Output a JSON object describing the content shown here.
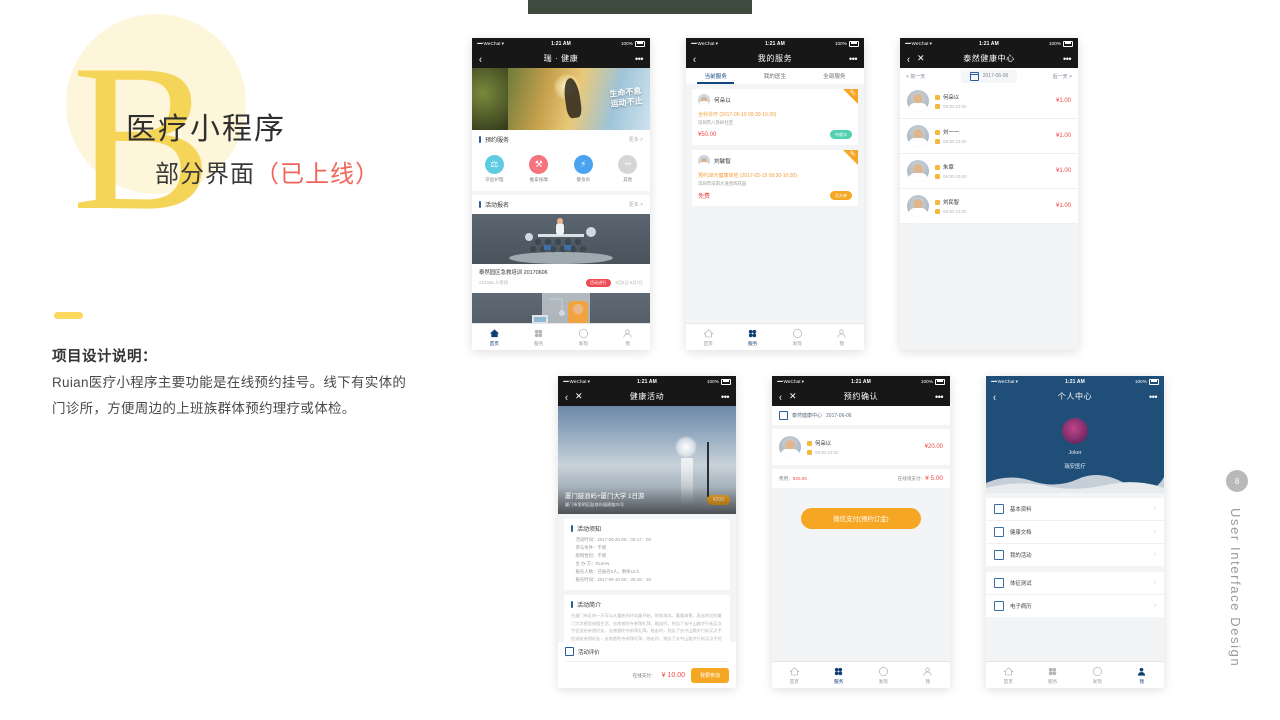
{
  "slide": {
    "section_letter": "B",
    "title": "医疗小程序",
    "subtitle_main": "部分界面",
    "subtitle_note": "（已上线）",
    "desc_heading": "项目设计说明：",
    "desc_body": "Ruian医疗小程序主要功能是在线预约挂号。线下有实体的门诊所，方便周边的上班族群体预约理疗或体检。",
    "rail_text": "User Interface Design",
    "page_badge": "8",
    "accent_yellow": "#f5d558",
    "accent_red": "#f0655a",
    "accent_blue": "#1f4e79"
  },
  "status_bar": {
    "carrier_dots": "•••••",
    "carrier": "WeChat",
    "wifi": "▾",
    "time": "1:21 AM",
    "battery": "100%"
  },
  "phone1": {
    "nav": {
      "back": "‹",
      "title": "瑞 · 健康",
      "more": "•••"
    },
    "hero_slogan_1": "生命不息",
    "hero_slogan_2": "运动不止",
    "section_services": {
      "label": "预约服务",
      "more": "更多 >"
    },
    "services": [
      {
        "label": "牙齿护理",
        "icon": "tooth-icon",
        "color": "#5ecbe2",
        "glyph": "⚕"
      },
      {
        "label": "推拿按摩",
        "icon": "massage-icon",
        "color": "#f4737d",
        "glyph": "⚘"
      },
      {
        "label": "健身房",
        "icon": "gym-icon",
        "color": "#4aa3f0",
        "glyph": "⚡"
      },
      {
        "label": "其他",
        "icon": "more-dots-icon",
        "color": "#d6d6d6",
        "glyph": "•••"
      }
    ],
    "section_activities": {
      "label": "活动报名",
      "more": "更多 >"
    },
    "activity": {
      "title": "泰然园区急救培训 20170606",
      "subtitle": "212345 人参加",
      "badge": "活动进行",
      "date": "6月6日-6月7日"
    },
    "tabbar": [
      {
        "label": "首页",
        "icon": "home-icon",
        "active": true
      },
      {
        "label": "服务",
        "icon": "grid-icon",
        "active": false
      },
      {
        "label": "发现",
        "icon": "compass-icon",
        "active": false
      },
      {
        "label": "我",
        "icon": "person-icon",
        "active": false
      }
    ]
  },
  "phone2": {
    "nav": {
      "back": "‹",
      "title": "我的服务",
      "more": "•••"
    },
    "tabs": [
      {
        "label": "当前服务",
        "active": true
      },
      {
        "label": "我的医生",
        "active": false
      },
      {
        "label": "全部服务",
        "active": false
      }
    ],
    "cards": [
      {
        "doctor": "何朵以",
        "corner": "预约",
        "service": "全科诊疗 (2017-05-19 09:30-10:30)",
        "address": "深圳市八卦岭社区",
        "price": "¥50.00",
        "status": "待就诊",
        "status_color": "green"
      },
      {
        "doctor": "刘敏智",
        "corner": "预约",
        "service": "预约38元健康体检 (2017-05-19 09:30-10:30)",
        "address": "深圳市深南大道金辉花园",
        "price": "免费",
        "status": "总方单",
        "status_color": "orange"
      }
    ],
    "tabbar": [
      {
        "label": "首页",
        "icon": "home-icon",
        "active": false
      },
      {
        "label": "服务",
        "icon": "grid-icon",
        "active": true
      },
      {
        "label": "发现",
        "icon": "compass-icon",
        "active": false
      },
      {
        "label": "我",
        "icon": "person-icon",
        "active": false
      }
    ]
  },
  "phone3": {
    "nav": {
      "back": "‹",
      "close": "✕",
      "title": "泰然健康中心",
      "more": "•••"
    },
    "date_bar": {
      "prev": "< 前一天",
      "date": "2017-06-06",
      "next": "后一天 >"
    },
    "doctors": [
      {
        "name": "何朵以",
        "time": "09:30-10:00",
        "price": "¥1.00"
      },
      {
        "name": "刘一一",
        "time": "09:30-10:00",
        "price": "¥1.00"
      },
      {
        "name": "朱章",
        "time": "09:30-10:00",
        "price": "¥1.00"
      },
      {
        "name": "刘民智",
        "time": "09:30-10:00",
        "price": "¥1.00"
      }
    ]
  },
  "phone4": {
    "nav": {
      "back": "‹",
      "close": "✕",
      "title": "健康活动",
      "more": "•••"
    },
    "hero": {
      "title": "厦门鼓浪屿+厦门大学 1日游",
      "address": "厦门市思明区鼓浪屿福建路31号",
      "price_badge": "¥200"
    },
    "notice": {
      "label": "活动须知",
      "items": [
        "活动时间：2017-06-20 09：00-17：00",
        "参与条件：不限",
        "限制性别：不限",
        "主 办 方：RUIAN",
        "报名人数：已报名0人，剩余10人",
        "报名时间：2017-06-10 09：30-16：30"
      ]
    },
    "intro": {
      "label": "活动简介",
      "text": "在厦门市区的一天可以从重新的环岛路开始，吹吹海风，看看海景，再去附近的厦门大学感受校园生活，去南普陀寺参拜礼拜，临走时，到店了去中山路步行街买点手信送给亲朋好友，去南普陀寺参拜礼拜，临走时，到店了去中山路步行街买点手信送给亲朋好友，去南普陀寺参拜礼拜，临走时，到店了去中山路步行街买点手信送给亲朋好友。"
    },
    "pay": {
      "review_label": "活动评价",
      "online_label": "在线支付：",
      "amount": "¥ 10.00",
      "button": "我要参加"
    }
  },
  "phone5": {
    "nav": {
      "back": "‹",
      "close": "✕",
      "title": "预约确认",
      "more": "•••"
    },
    "clinic": {
      "name": "泰然健康中心",
      "date": "2017-06-06"
    },
    "booking": {
      "doctor": "何朵以",
      "time": "09:30-10:00",
      "price": "¥20.00"
    },
    "summary": {
      "fee_label": "费用：",
      "fee": "¥20.00",
      "online_label": "在线请支付：",
      "online": "¥ 5.00"
    },
    "button": "微信支付(预约订金)",
    "tabbar": [
      {
        "label": "首页",
        "icon": "home-icon",
        "active": false
      },
      {
        "label": "服务",
        "icon": "grid-icon",
        "active": true
      },
      {
        "label": "发现",
        "icon": "compass-icon",
        "active": false
      },
      {
        "label": "我",
        "icon": "person-icon",
        "active": false
      }
    ]
  },
  "phone6": {
    "nav": {
      "back": "‹",
      "title": "个人中心",
      "more": "•••"
    },
    "profile": {
      "name": "Joker",
      "org": "瑞安医疗"
    },
    "menu_group_1": [
      {
        "label": "基本资料",
        "icon": "id-card-icon"
      },
      {
        "label": "健康文档",
        "icon": "document-icon"
      },
      {
        "label": "我的活动",
        "icon": "activity-icon"
      }
    ],
    "menu_group_2": [
      {
        "label": "体征测试",
        "icon": "vitals-icon"
      },
      {
        "label": "电子病历",
        "icon": "medical-record-icon"
      }
    ],
    "tabbar": [
      {
        "label": "首页",
        "icon": "home-icon",
        "active": false
      },
      {
        "label": "服务",
        "icon": "grid-icon",
        "active": false
      },
      {
        "label": "发现",
        "icon": "compass-icon",
        "active": false
      },
      {
        "label": "我",
        "icon": "person-icon",
        "active": true
      }
    ]
  }
}
